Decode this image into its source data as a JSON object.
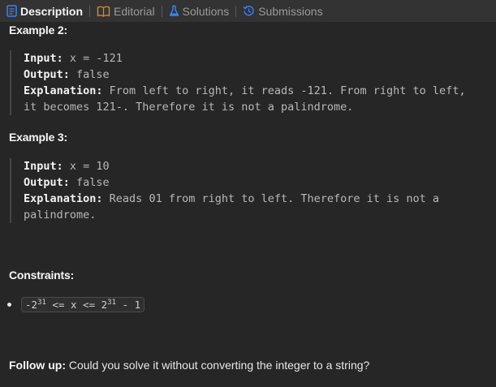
{
  "tabs": [
    {
      "label": "Description",
      "icon": "document-icon",
      "active": true
    },
    {
      "label": "Editorial",
      "icon": "book-icon",
      "active": false
    },
    {
      "label": "Solutions",
      "icon": "flask-icon",
      "active": false
    },
    {
      "label": "Submissions",
      "icon": "history-icon",
      "active": false
    }
  ],
  "colors": {
    "accent_blue": "#3b82f6",
    "editorial_orange": "#d98a2b",
    "background": "#262626",
    "tabbar": "#333333"
  },
  "example2": {
    "heading": "Example 2:",
    "input_label": "Input:",
    "input_value": " x = -121",
    "output_label": "Output:",
    "output_value": " false",
    "explanation_label": "Explanation:",
    "explanation_line1": " From left to right, it reads -121. From right to left,",
    "explanation_line2": "it becomes 121-. Therefore it is not a palindrome."
  },
  "example3": {
    "heading": "Example 3:",
    "input_label": "Input:",
    "input_value": " x = 10",
    "output_label": "Output:",
    "output_value": " false",
    "explanation_label": "Explanation:",
    "explanation_line1": " Reads 01 from right to left. Therefore it is not a",
    "explanation_line2": "palindrome."
  },
  "constraints": {
    "heading": "Constraints:",
    "chip_prefix": "-2",
    "chip_exp1": "31",
    "chip_middle": " <= x <= 2",
    "chip_exp2": "31",
    "chip_suffix": " - 1"
  },
  "follow_up": {
    "label": "Follow up:",
    "text": " Could you solve it without converting the integer to a string?"
  }
}
